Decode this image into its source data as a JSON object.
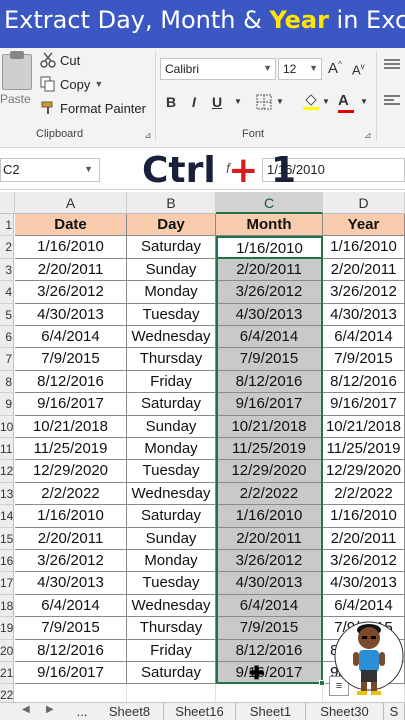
{
  "banner": {
    "prefix": "Extract Day, Month & ",
    "highlight": "Year",
    "suffix": " in Exce"
  },
  "ribbon": {
    "paste_label": "Paste",
    "cut_label": "Cut",
    "copy_label": "Copy",
    "format_painter_label": "Format Painter",
    "clipboard_group": "Clipboard",
    "font_name": "Calibri",
    "font_size": "12",
    "grow_font": "A",
    "shrink_font": "A",
    "bold": "B",
    "italic": "I",
    "underline": "U",
    "font_color_glyph": "A",
    "font_group": "Font"
  },
  "formula_bar": {
    "name_box": "C2",
    "fx": "f",
    "value": "1/16/2010"
  },
  "overlay": {
    "hotkey_ctrl": "Ctrl ",
    "hotkey_plus": "+",
    "hotkey_key": " 1"
  },
  "grid": {
    "columns": [
      "A",
      "B",
      "C",
      "D"
    ],
    "selected_column": "C",
    "headers": [
      "Date",
      "Day",
      "Month",
      "Year"
    ],
    "row_numbers": [
      "1",
      "2",
      "3",
      "4",
      "5",
      "6",
      "7",
      "8",
      "9",
      "10",
      "11",
      "12",
      "13",
      "14",
      "15",
      "16",
      "17",
      "18",
      "19",
      "20",
      "21",
      "22"
    ],
    "rows": [
      [
        "1/16/2010",
        "Saturday",
        "1/16/2010",
        "1/16/2010"
      ],
      [
        "2/20/2011",
        "Sunday",
        "2/20/2011",
        "2/20/2011"
      ],
      [
        "3/26/2012",
        "Monday",
        "3/26/2012",
        "3/26/2012"
      ],
      [
        "4/30/2013",
        "Tuesday",
        "4/30/2013",
        "4/30/2013"
      ],
      [
        "6/4/2014",
        "Wednesday",
        "6/4/2014",
        "6/4/2014"
      ],
      [
        "7/9/2015",
        "Thursday",
        "7/9/2015",
        "7/9/2015"
      ],
      [
        "8/12/2016",
        "Friday",
        "8/12/2016",
        "8/12/2016"
      ],
      [
        "9/16/2017",
        "Saturday",
        "9/16/2017",
        "9/16/2017"
      ],
      [
        "10/21/2018",
        "Sunday",
        "10/21/2018",
        "10/21/2018"
      ],
      [
        "11/25/2019",
        "Monday",
        "11/25/2019",
        "11/25/2019"
      ],
      [
        "12/29/2020",
        "Tuesday",
        "12/29/2020",
        "12/29/2020"
      ],
      [
        "2/2/2022",
        "Wednesday",
        "2/2/2022",
        "2/2/2022"
      ],
      [
        "1/16/2010",
        "Saturday",
        "1/16/2010",
        "1/16/2010"
      ],
      [
        "2/20/2011",
        "Sunday",
        "2/20/2011",
        "2/20/2011"
      ],
      [
        "3/26/2012",
        "Monday",
        "3/26/2012",
        "3/26/2012"
      ],
      [
        "4/30/2013",
        "Tuesday",
        "4/30/2013",
        "4/30/2013"
      ],
      [
        "6/4/2014",
        "Wednesday",
        "6/4/2014",
        "6/4/2014"
      ],
      [
        "7/9/2015",
        "Thursday",
        "7/9/2015",
        "7/9/2015"
      ],
      [
        "8/12/2016",
        "Friday",
        "8/12/2016",
        "8/12/2016"
      ],
      [
        "9/16/2017",
        "Saturday",
        "9/16/2017",
        "9/16/2017"
      ]
    ]
  },
  "sheet_tabs": [
    "...",
    "Sheet8",
    "Sheet16",
    "Sheet1",
    "Sheet30",
    "S"
  ],
  "colors": {
    "banner": "#3b57c4",
    "banner_highlight": "#ffe600",
    "header_fill": "#f8cbad",
    "selected_fill": "#c9c9c9",
    "excel_green": "#217346",
    "hotkey_plus": "#d81b1b"
  }
}
